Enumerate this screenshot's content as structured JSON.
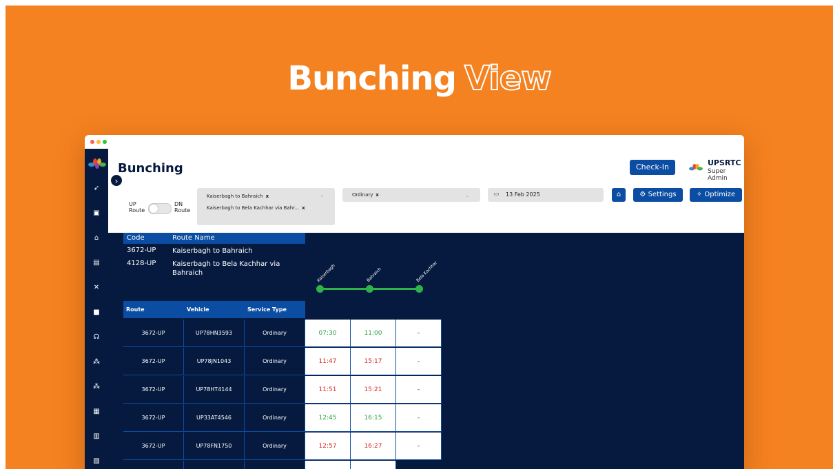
{
  "headline": {
    "word1": "Bunching",
    "word2": "View"
  },
  "colors": {
    "brand_orange": "#F58220",
    "navy": "#061A3F",
    "primary_blue": "#0B4DA2",
    "on_time_green": "#2E9E3E",
    "late_red": "#D62828"
  },
  "header": {
    "title": "Bunching",
    "checkin_label": "Check-In",
    "org_name": "UPSRTC",
    "org_role": "Super Admin"
  },
  "sidebar": {
    "expand_icon": "chevron-right-icon",
    "icons": [
      "rocket-icon",
      "bus-icon",
      "depot-icon",
      "fuel-icon",
      "tools-icon",
      "ticket-icon",
      "headset-icon",
      "org-chart-icon",
      "org-chart-icon",
      "document-icon",
      "calendar-icon",
      "id-card-icon"
    ]
  },
  "filters": {
    "up_label_1": "UP",
    "up_label_2": "Route",
    "dn_label_1": "DN",
    "dn_label_2": "Route",
    "routes": [
      "Kaiserbagh to Bahraich",
      "Kaiserbagh to Bela Kachhar via Bahr..."
    ],
    "chip_remove": "x",
    "service_type": "Ordinary",
    "date": "13 Feb 2025",
    "settings_label": "Settings",
    "optimize_label": "Optimize"
  },
  "legend": {
    "header_code": "Code",
    "header_name": "Route Name",
    "rows": [
      {
        "code": "3672-UP",
        "name": "Kaiserbagh to Bahraich"
      },
      {
        "code": "4128-UP",
        "name": "Kaiserbagh to Bela Kachhar via Bahraich"
      }
    ]
  },
  "stops": [
    "Kaiserbagh",
    "Bahraich",
    "Bela Kachhar"
  ],
  "grid": {
    "headers": {
      "route": "Route",
      "vehicle": "Vehicle",
      "service_type": "Service Type"
    },
    "rows": [
      {
        "route": "3672-UP",
        "vehicle": "UP78HN3593",
        "type": "Ordinary",
        "t1": "07:30",
        "t1_status": "green",
        "t2": "11:00",
        "t2_status": "green",
        "t3": "-"
      },
      {
        "route": "3672-UP",
        "vehicle": "UP78JN1043",
        "type": "Ordinary",
        "t1": "11:47",
        "t1_status": "red",
        "t2": "15:17",
        "t2_status": "red",
        "t3": "-"
      },
      {
        "route": "3672-UP",
        "vehicle": "UP78HT4144",
        "type": "Ordinary",
        "t1": "11:51",
        "t1_status": "red",
        "t2": "15:21",
        "t2_status": "red",
        "t3": "-"
      },
      {
        "route": "3672-UP",
        "vehicle": "UP33AT4546",
        "type": "Ordinary",
        "t1": "12:45",
        "t1_status": "green",
        "t2": "16:15",
        "t2_status": "green",
        "t3": "-"
      },
      {
        "route": "3672-UP",
        "vehicle": "UP78FN1750",
        "type": "Ordinary",
        "t1": "12:57",
        "t1_status": "red",
        "t2": "16:27",
        "t2_status": "red",
        "t3": "-"
      }
    ]
  }
}
